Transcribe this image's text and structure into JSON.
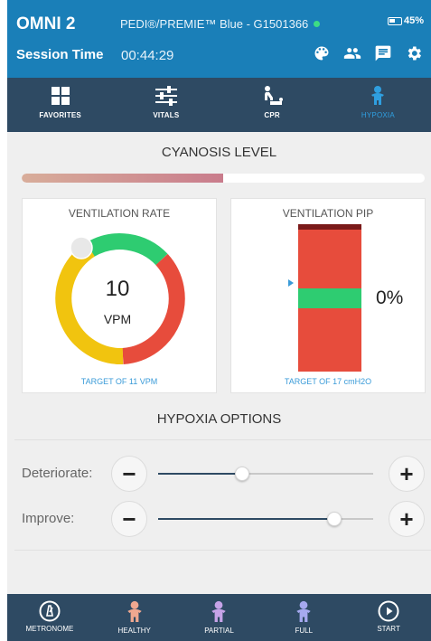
{
  "header": {
    "brand": "OMNI 2",
    "device": "PEDI®/PREMIE™ Blue - G1501366",
    "battery": "45%",
    "session_label": "Session Time",
    "session_time": "00:44:29",
    "icons": [
      "palette-icon",
      "people-icon",
      "chat-icon",
      "gear-icon"
    ]
  },
  "tabs": [
    {
      "label": "FAVORITES",
      "icon": "grid-icon",
      "active": false
    },
    {
      "label": "VITALS",
      "icon": "sliders-icon",
      "active": false
    },
    {
      "label": "CPR",
      "icon": "cpr-icon",
      "active": false
    },
    {
      "label": "HYPOXIA",
      "icon": "baby-icon",
      "active": true
    }
  ],
  "cyanosis": {
    "title": "CYANOSIS LEVEL",
    "level": 0.5
  },
  "ventilation_rate": {
    "title": "VENTILATION RATE",
    "value": "10",
    "unit": "VPM",
    "target": "TARGET OF 11 VPM"
  },
  "ventilation_pip": {
    "title": "VENTILATION PIP",
    "value": "0%",
    "target": "TARGET OF 17 cmH2O"
  },
  "hypoxia_options": {
    "title": "HYPOXIA OPTIONS",
    "rows": [
      {
        "label": "Deteriorate:",
        "level": 0.39
      },
      {
        "label": "Improve:",
        "level": 0.82
      }
    ]
  },
  "bottom_bar": [
    {
      "label": "METRONOME",
      "icon": "metronome-icon"
    },
    {
      "label": "HEALTHY",
      "icon": "baby-healthy-icon",
      "color": "#f0a890"
    },
    {
      "label": "PARTIAL",
      "icon": "baby-partial-icon",
      "color": "#c6a3e8"
    },
    {
      "label": "FULL",
      "icon": "baby-full-icon",
      "color": "#a6a9f0"
    },
    {
      "label": "START",
      "icon": "play-icon"
    }
  ],
  "colors": {
    "header_blue": "#1a7fb8",
    "nav_dark": "#2e4a63",
    "active_blue": "#2f9fe0",
    "gauge_green": "#2ecc71",
    "gauge_red": "#e74c3c",
    "gauge_yellow": "#f1c40f"
  }
}
